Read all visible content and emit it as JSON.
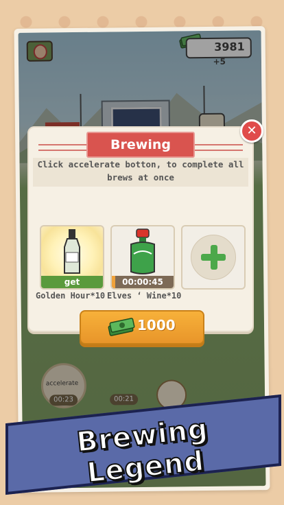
{
  "hud": {
    "cash_total": "3981",
    "cash_rate": "+5",
    "icons": [
      "avatar-icon",
      "cash-stack-icon"
    ]
  },
  "game": {
    "accelerate_label": "accelerate",
    "timer_left": "00:23",
    "timer_right": "00:21"
  },
  "dialog": {
    "title": "Brewing",
    "close_icon": "close-x-icon",
    "description_line1": "Click accelerate botton, to complete all",
    "description_line2": "brews at once",
    "slots": [
      {
        "item_icon": "champagne-bottle-icon",
        "status": "get",
        "label": "Golden Hour*10"
      },
      {
        "item_icon": "green-wine-bottle-icon",
        "status": "00:00:45",
        "progress": 0.05,
        "label": "Elves ‘ Wine*10"
      },
      {
        "item_icon": "plus-icon",
        "status": "",
        "label": ""
      }
    ],
    "accelerate_cost": "1000"
  },
  "banner": {
    "text": "Brewing Legend"
  },
  "colors": {
    "title_red": "#d9544f",
    "button_orange": "#f0a23a",
    "get_green": "#5a9a3c",
    "banner_blue": "#5a6aa8"
  }
}
